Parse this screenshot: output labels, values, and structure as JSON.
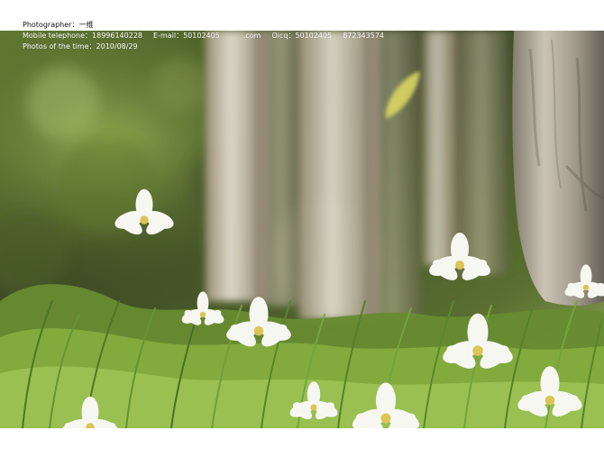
{
  "meta": {
    "photographer": "Photographer：一维",
    "mobile": "Mobile telephone：18996140228",
    "email": "E-mail：50102405",
    "email_suffix": ".com",
    "oicq": "Oicq：50102405",
    "oicq_suffix": "872343574",
    "photo_time": "Photos of the time：2010/08/29"
  },
  "colors": {
    "background": "#ffffff",
    "foliage_dark": "#2f3e16",
    "foliage_mid": "#6d8b2d",
    "grass": "#83b03b",
    "flower": "#f7f7f2",
    "flower_center": "#d8c24b",
    "trunk": "#d8d0bb"
  }
}
